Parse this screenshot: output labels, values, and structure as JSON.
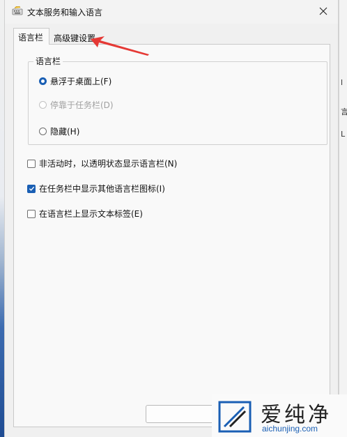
{
  "window": {
    "title": "文本服务和输入语言",
    "close_icon": "close-icon"
  },
  "tabs": [
    {
      "label": "语言栏",
      "active": true
    },
    {
      "label": "高级键设置",
      "active": false
    }
  ],
  "language_bar_group": {
    "title": "语言栏",
    "options": [
      {
        "label": "悬浮于桌面上(F)",
        "checked": true,
        "enabled": true
      },
      {
        "label": "停靠于任务栏(D)",
        "checked": false,
        "enabled": false
      },
      {
        "label": "隐藏(H)",
        "checked": false,
        "enabled": true
      }
    ]
  },
  "checkboxes": [
    {
      "label": "非活动时，以透明状态显示语言栏(N)",
      "checked": false
    },
    {
      "label": "在任务栏中显示其他语言栏图标(I)",
      "checked": true
    },
    {
      "label": "在语言栏上显示文本标签(E)",
      "checked": false
    }
  ],
  "watermark": {
    "brand": "爱纯净",
    "url": "aichunjing.com"
  },
  "colors": {
    "accent": "#1a5fb4",
    "arrow": "#e53935"
  }
}
